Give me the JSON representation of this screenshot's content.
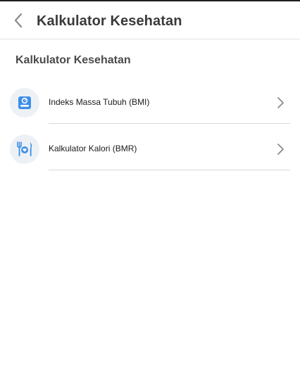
{
  "header": {
    "title": "Kalkulator Kesehatan",
    "back_icon": "chevron-left-icon"
  },
  "section": {
    "title": "Kalkulator Kesehatan"
  },
  "menu": {
    "items": [
      {
        "label": "Indeks Massa Tubuh (BMI)",
        "icon": "scale-icon"
      },
      {
        "label": "Kalkulator Kalori (BMR)",
        "icon": "fork-knife-heart-icon"
      }
    ]
  },
  "colors": {
    "icon_blue": "#3d8fe8",
    "icon_background": "#edf1f5",
    "chevron": "#8a8a8a"
  }
}
